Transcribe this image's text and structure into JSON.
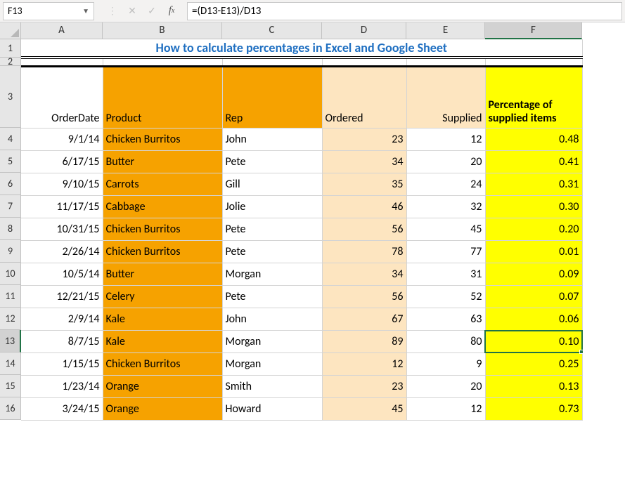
{
  "name_box": {
    "value": "F13"
  },
  "formula_bar": {
    "cancel_glyph": "✕",
    "enter_glyph": "✓",
    "fx_label": "f",
    "fx_sub": "x",
    "formula": "=(D13-E13)/D13"
  },
  "columns": {
    "A": "A",
    "B": "B",
    "C": "C",
    "D": "D",
    "E": "E",
    "F": "F"
  },
  "row_numbers": [
    "1",
    "2",
    "3",
    "4",
    "5",
    "6",
    "7",
    "8",
    "9",
    "10",
    "11",
    "12",
    "13",
    "14",
    "15",
    "16"
  ],
  "title": "How to calculate percentages in Excel and Google Sheet",
  "headers": {
    "order_date": "OrderDate",
    "product": "Product",
    "rep": "Rep",
    "ordered": "Ordered",
    "supplied": "Supplied",
    "percentage": "Percentage of supplied items"
  },
  "rows": [
    {
      "date": "9/1/14",
      "product": "Chicken Burritos",
      "rep": "John",
      "ordered": "23",
      "supplied": "12",
      "pct": "0.48"
    },
    {
      "date": "6/17/15",
      "product": "Butter",
      "rep": "Pete",
      "ordered": "34",
      "supplied": "20",
      "pct": "0.41"
    },
    {
      "date": "9/10/15",
      "product": "Carrots",
      "rep": "Gill",
      "ordered": "35",
      "supplied": "24",
      "pct": "0.31"
    },
    {
      "date": "11/17/15",
      "product": "Cabbage",
      "rep": "Jolie",
      "ordered": "46",
      "supplied": "32",
      "pct": "0.30"
    },
    {
      "date": "10/31/15",
      "product": "Chicken Burritos",
      "rep": "Pete",
      "ordered": "56",
      "supplied": "45",
      "pct": "0.20"
    },
    {
      "date": "2/26/14",
      "product": "Chicken Burritos",
      "rep": "Pete",
      "ordered": "78",
      "supplied": "77",
      "pct": "0.01"
    },
    {
      "date": "10/5/14",
      "product": "Butter",
      "rep": "Morgan",
      "ordered": "34",
      "supplied": "31",
      "pct": "0.09"
    },
    {
      "date": "12/21/15",
      "product": "Celery",
      "rep": "Pete",
      "ordered": "56",
      "supplied": "52",
      "pct": "0.07"
    },
    {
      "date": "2/9/14",
      "product": "Kale",
      "rep": "John",
      "ordered": "67",
      "supplied": "63",
      "pct": "0.06"
    },
    {
      "date": "8/7/15",
      "product": "Kale",
      "rep": "Morgan",
      "ordered": "89",
      "supplied": "80",
      "pct": "0.10"
    },
    {
      "date": "1/15/15",
      "product": "Chicken Burritos",
      "rep": "Morgan",
      "ordered": "12",
      "supplied": "9",
      "pct": "0.25"
    },
    {
      "date": "1/23/14",
      "product": "Orange",
      "rep": "Smith",
      "ordered": "23",
      "supplied": "20",
      "pct": "0.13"
    },
    {
      "date": "3/24/15",
      "product": "Orange",
      "rep": "Howard",
      "ordered": "45",
      "supplied": "12",
      "pct": "0.73"
    }
  ],
  "selection": {
    "active_row_index": 12,
    "active_col": "F"
  }
}
